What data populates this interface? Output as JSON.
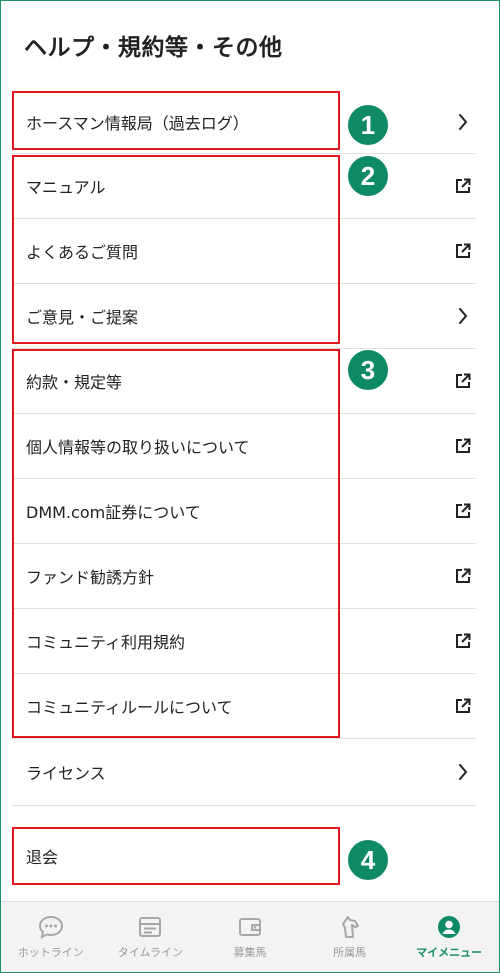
{
  "header": {
    "title": "ヘルプ・規約等・その他"
  },
  "menu": {
    "items": [
      {
        "label": "ホースマン情報局（過去ログ）",
        "action": "chevron-right"
      },
      {
        "label": "マニュアル",
        "action": "external-link"
      },
      {
        "label": "よくあるご質問",
        "action": "external-link"
      },
      {
        "label": "ご意見・ご提案",
        "action": "chevron-right"
      },
      {
        "label": "約款・規定等",
        "action": "external-link"
      },
      {
        "label": "個人情報等の取り扱いについて",
        "action": "external-link"
      },
      {
        "label": "DMM.com証券について",
        "action": "external-link"
      },
      {
        "label": "ファンド勧誘方針",
        "action": "external-link"
      },
      {
        "label": "コミュニティ利用規約",
        "action": "external-link"
      },
      {
        "label": "コミュニティルールについて",
        "action": "external-link"
      },
      {
        "label": "ライセンス",
        "action": "chevron-right"
      },
      {
        "label": "退会",
        "action": "none"
      }
    ]
  },
  "badges": [
    "1",
    "2",
    "3",
    "4"
  ],
  "annotation_color": "#e01a1a",
  "badge_color": "#0f8a66",
  "tabbar": {
    "tabs": [
      {
        "label": "ホットライン",
        "icon": "chat-bubble-icon",
        "active": false
      },
      {
        "label": "タイムライン",
        "icon": "timeline-icon",
        "active": false
      },
      {
        "label": "募集馬",
        "icon": "wallet-icon",
        "active": false
      },
      {
        "label": "所属馬",
        "icon": "horse-icon",
        "active": false
      },
      {
        "label": "マイメニュー",
        "icon": "user-icon",
        "active": true
      }
    ],
    "active_color": "#0f8a66"
  }
}
